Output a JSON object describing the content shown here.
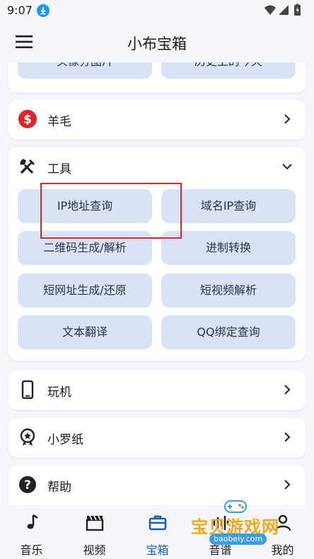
{
  "status_bar": {
    "time": "9:07"
  },
  "app_bar": {
    "title": "小布宝箱"
  },
  "sections": {
    "top_partial": {
      "left_chip": "头像分图片",
      "right_chip": "历史上的今天"
    },
    "yangmao": {
      "label": "羊毛"
    },
    "tools": {
      "label": "工具",
      "items": [
        "IP地址查询",
        "域名IP查询",
        "二维码生成/解析",
        "进制转换",
        "短网址生成/还原",
        "短视频解析",
        "文本翻译",
        "QQ绑定查询"
      ]
    },
    "wanji": {
      "label": "玩机"
    },
    "xiaoluozhi": {
      "label": "小罗纸"
    },
    "help": {
      "label": "帮助"
    }
  },
  "bottom_nav": {
    "items": [
      {
        "label": "音乐",
        "icon": "music-note-icon"
      },
      {
        "label": "视频",
        "icon": "clapperboard-icon"
      },
      {
        "label": "宝箱",
        "icon": "briefcase-icon"
      },
      {
        "label": "音谱",
        "icon": "waveform-icon"
      },
      {
        "label": "我的",
        "icon": "person-icon"
      }
    ],
    "active_index": 2
  },
  "watermark": {
    "text": "宝贝游戏网",
    "url": "baobeiy.com"
  },
  "colors": {
    "accent": "#1f5fa8",
    "chip": "#d8e3f6",
    "highlight_box": "#d9262f",
    "dollar_badge": "#d9262f"
  }
}
